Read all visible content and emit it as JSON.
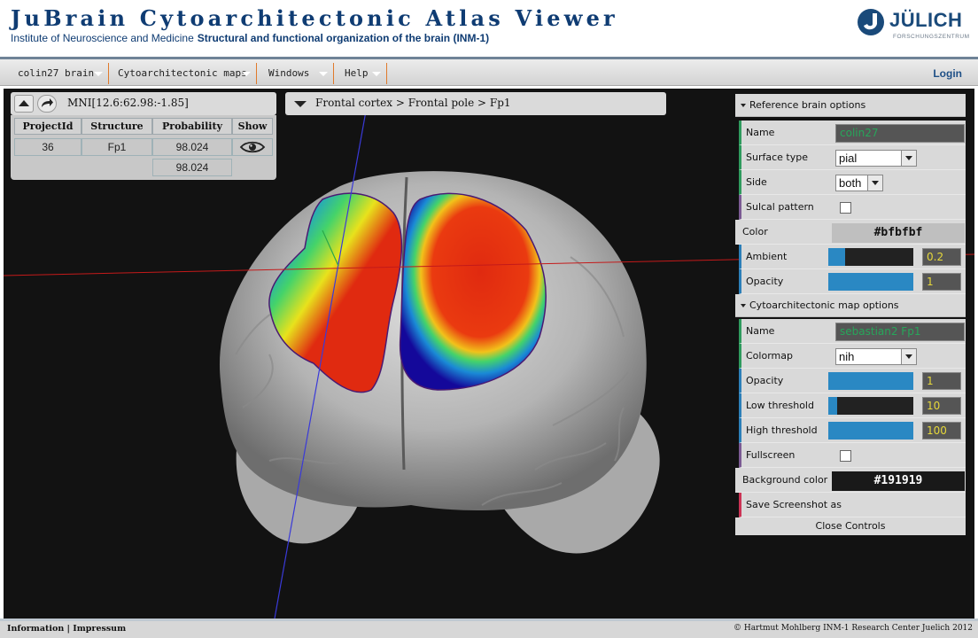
{
  "header": {
    "title": "JuBrain Cytoarchitectonic Atlas Viewer",
    "institute": "Institute of Neuroscience and Medicine",
    "division": "Structural and functional organization of the brain (INM-1)",
    "logo_text": "JÜLICH",
    "logo_subtext": "FORSCHUNGSZENTRUM"
  },
  "menubar": {
    "items": [
      {
        "label": "colin27 brain"
      },
      {
        "label": "Cytoarchitectonic maps"
      },
      {
        "label": "Windows"
      },
      {
        "label": "Help"
      }
    ],
    "login": "Login"
  },
  "toolbar": {
    "coordinate": "MNI[12.6:62.98:-1.85]",
    "breadcrumb": "Frontal cortex > Frontal pole > Fp1"
  },
  "results": {
    "headers": [
      "ProjectId",
      "Structure",
      "Probability",
      "Show"
    ],
    "rows": [
      {
        "project_id": "36",
        "structure": "Fp1",
        "probability": "98.024"
      },
      {
        "project_id": "",
        "structure": "",
        "probability": "98.024"
      }
    ]
  },
  "controls": {
    "reference": {
      "header": "Reference brain options",
      "name_label": "Name",
      "name_value": "colin27",
      "surface_label": "Surface type",
      "surface_value": "pial",
      "side_label": "Side",
      "side_value": "both",
      "sulcal_label": "Sulcal pattern",
      "sulcal_checked": false,
      "color_label": "Color",
      "color_value": "#bfbfbf",
      "ambient_label": "Ambient",
      "ambient_value": "0.2",
      "ambient_fraction": 0.2,
      "opacity_label": "Opacity",
      "opacity_value": "1",
      "opacity_fraction": 1
    },
    "cyto": {
      "header": "Cytoarchitectonic map options",
      "name_label": "Name",
      "name_value": "sebastian2 Fp1",
      "colormap_label": "Colormap",
      "colormap_value": "nih",
      "opacity_label": "Opacity",
      "opacity_value": "1",
      "opacity_fraction": 1,
      "low_label": "Low threshold",
      "low_value": "10",
      "low_fraction": 0.1,
      "high_label": "High threshold",
      "high_value": "100",
      "high_fraction": 1
    },
    "fullscreen_label": "Fullscreen",
    "fullscreen_checked": false,
    "background_label": "Background color",
    "background_value": "#191919",
    "screenshot_label": "Save Screenshot as",
    "close_label": "Close Controls"
  },
  "colors": {
    "accent_green": "#2f9a5d",
    "accent_blue": "#2c7fb8",
    "slider_fill": "#2a88c3",
    "title_blue": "#0f3c73",
    "viewer_background": "#191919"
  },
  "footer": {
    "links": "Information | Impressum",
    "copyright": "© Hartmut Mohlberg INM-1 Research Center Juelich 2012"
  }
}
